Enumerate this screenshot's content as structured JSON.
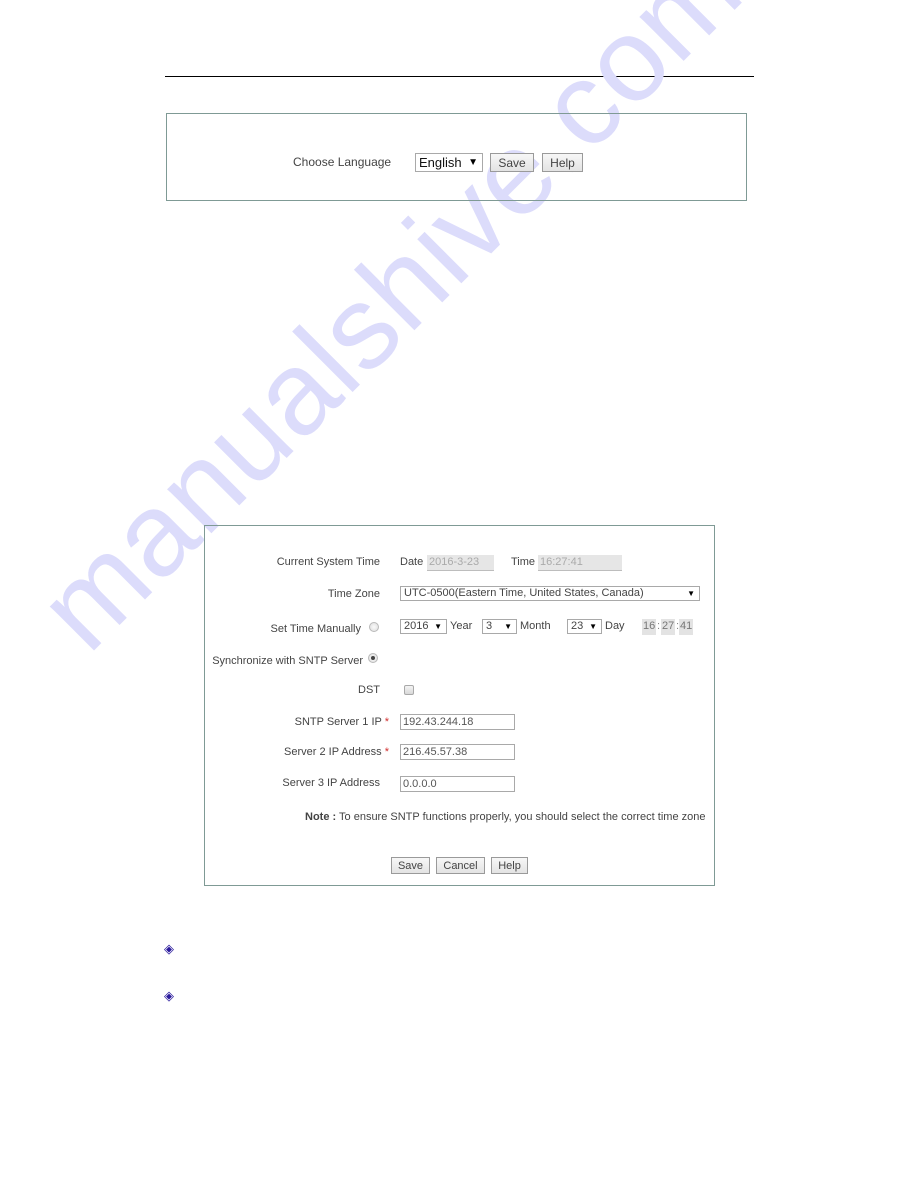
{
  "watermark": "manualshive.com",
  "language_panel": {
    "label": "Choose Language",
    "language_select": {
      "selected": "English"
    },
    "save_label": "Save",
    "help_label": "Help"
  },
  "time_panel": {
    "current_system_time": {
      "label": "Current System Time",
      "date_label": "Date",
      "date_value": "2016-3-23",
      "time_label": "Time",
      "time_value": "16:27:41"
    },
    "time_zone": {
      "label": "Time Zone",
      "selected": "UTC-0500(Eastern Time, United States, Canada)"
    },
    "set_time_manually": {
      "label": "Set Time Manually",
      "checked": false,
      "year": {
        "selected": "2016",
        "label": "Year"
      },
      "month": {
        "selected": "3",
        "label": "Month"
      },
      "day": {
        "selected": "23",
        "label": "Day"
      },
      "hour": "16",
      "minute": "27",
      "second": "41",
      "separator": ":"
    },
    "sync_sntp": {
      "label": "Synchronize with SNTP Server",
      "checked": true
    },
    "dst": {
      "label": "DST",
      "checked": false
    },
    "sntp_server_1": {
      "label": "SNTP Server 1 IP",
      "required_mark": "*",
      "value": "192.43.244.18"
    },
    "server_2": {
      "label": "Server 2 IP Address",
      "required_mark": "*",
      "value": "216.45.57.38"
    },
    "server_3": {
      "label": "Server 3 IP Address",
      "value": "0.0.0.0"
    },
    "note": {
      "prefix": "Note :",
      "text": "To ensure SNTP functions properly, you should select the correct time zone"
    },
    "buttons": {
      "save": "Save",
      "cancel": "Cancel",
      "help": "Help"
    }
  },
  "bullets": [
    {
      "icon": "diamond-bullet-icon",
      "glyph": "◈"
    },
    {
      "icon": "diamond-bullet-icon",
      "glyph": "◈"
    }
  ],
  "colors": {
    "panel_border": "#7f9a95",
    "required_mark": "#d12f2f",
    "bullet": "#2a1a9c",
    "watermark": "#dcdcfb"
  }
}
